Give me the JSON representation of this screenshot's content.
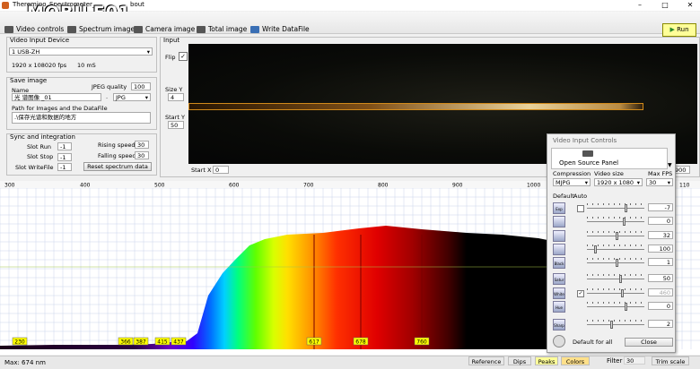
{
  "window": {
    "title": "Theremino_Spectrometer_",
    "title_suffix": "bout",
    "watermark": "MOBILE01"
  },
  "toolbar": {
    "video_controls": "Video controls",
    "spectrum_image": "Spectrum image",
    "camera_image": "Camera image",
    "total_image": "Total image",
    "write_datafile": "Write DataFile",
    "run": "Run"
  },
  "video_input": {
    "header": "Video Input Device",
    "device": "1 USB-ZH",
    "resolution": "1920 x 1080",
    "fps": "20 fps",
    "exposure": "10 mS"
  },
  "save_image": {
    "header": "Save image",
    "name_label": "Name",
    "jpeg_label": "JPEG quality",
    "jpeg_value": "100",
    "name_value": "光 谱图像 _01",
    "dot": ".",
    "format": "JPG",
    "path_label": "Path for Images and the DataFile",
    "path_value": ".\\保存光谱和数据的地方"
  },
  "sync": {
    "header": "Sync and integration",
    "slot_run_label": "Slot Run",
    "slot_run": "-1",
    "slot_stop_label": "Slot Stop",
    "slot_stop": "-1",
    "slot_write_label": "Slot WriteFile",
    "slot_write": "-1",
    "rising_label": "Rising speed",
    "rising": "30",
    "falling_label": "Falling speed",
    "falling": "30",
    "reset_btn": "Reset spectrum data"
  },
  "input": {
    "header": "Input",
    "flip_label": "Flip",
    "size_y_label": "Size Y",
    "size_y": "4",
    "start_y_label": "Start Y",
    "start_y": "50",
    "start_x_label": "Start X",
    "start_x": "0",
    "end_x": "900"
  },
  "chart_data": {
    "type": "area",
    "x_ticks": [
      "300",
      "400",
      "500",
      "600",
      "700",
      "800",
      "900",
      "1000",
      "110"
    ],
    "peak_markers": [
      "230",
      "366",
      "387",
      "415",
      "437",
      "617",
      "678",
      "760"
    ],
    "xlabel": "",
    "ylabel": ""
  },
  "status": {
    "max_nm": "Max: 674 nm",
    "reference": "Reference",
    "dips": "Dips",
    "peaks": "Peaks",
    "colors": "Colors",
    "filter_label": "Filter",
    "filter_value": "30",
    "trim_scale": "Trim scale"
  },
  "controls_panel": {
    "title": "Video Input Controls",
    "open_source": "Open Source Panel",
    "compression_label": "Compression",
    "compression": "MJPG",
    "video_size_label": "Video size",
    "video_size": "1920 x 1080",
    "max_fps_label": "Max FPS",
    "max_fps": "30",
    "default_label": "Default",
    "auto_label": "Auto",
    "rows": [
      {
        "icon": "Exp",
        "value": "-7"
      },
      {
        "icon": "",
        "value": "0"
      },
      {
        "icon": "",
        "value": "32"
      },
      {
        "icon": "",
        "value": "100"
      },
      {
        "icon": "Black light",
        "value": "1"
      },
      {
        "icon": "Satur",
        "value": "50"
      },
      {
        "icon": "White",
        "value": "460"
      },
      {
        "icon": "Hue",
        "value": "0"
      },
      {
        "icon": "Sharp",
        "value": "2"
      }
    ],
    "default_all": "Default for all",
    "close": "Close"
  },
  "colors": {
    "highlight": "#ffff99",
    "peak_marker": "#ffff00",
    "grid": "#c9d4ea"
  }
}
